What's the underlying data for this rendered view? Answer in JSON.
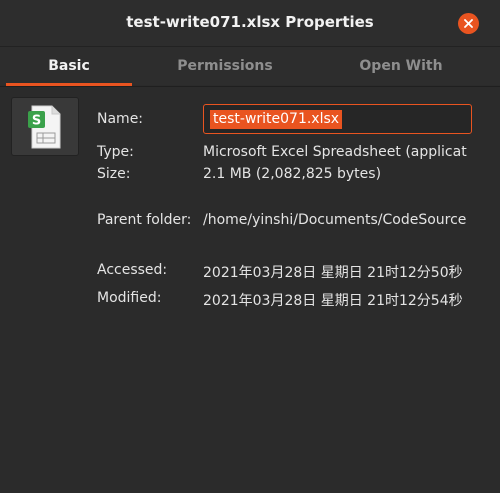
{
  "window": {
    "title": "test-write071.xlsx Properties",
    "accent_color": "#e95420",
    "close_icon": "close-icon"
  },
  "tabs": [
    {
      "label": "Basic",
      "active": true
    },
    {
      "label": "Permissions",
      "active": false
    },
    {
      "label": "Open With",
      "active": false
    }
  ],
  "file": {
    "icon": "spreadsheet-file-icon",
    "name_label": "Name:",
    "name_value": "test-write071.xlsx",
    "type_label": "Type:",
    "type_value": "Microsoft Excel Spreadsheet (applicat",
    "size_label": "Size:",
    "size_value": "2.1 MB (2,082,825 bytes)",
    "parent_label": "Parent folder:",
    "parent_value": "/home/yinshi/Documents/CodeSource",
    "accessed_label": "Accessed:",
    "accessed_value": "2021年03月28日 星期日 21时12分50秒",
    "modified_label": "Modified:",
    "modified_value": "2021年03月28日 星期日 21时12分54秒"
  }
}
